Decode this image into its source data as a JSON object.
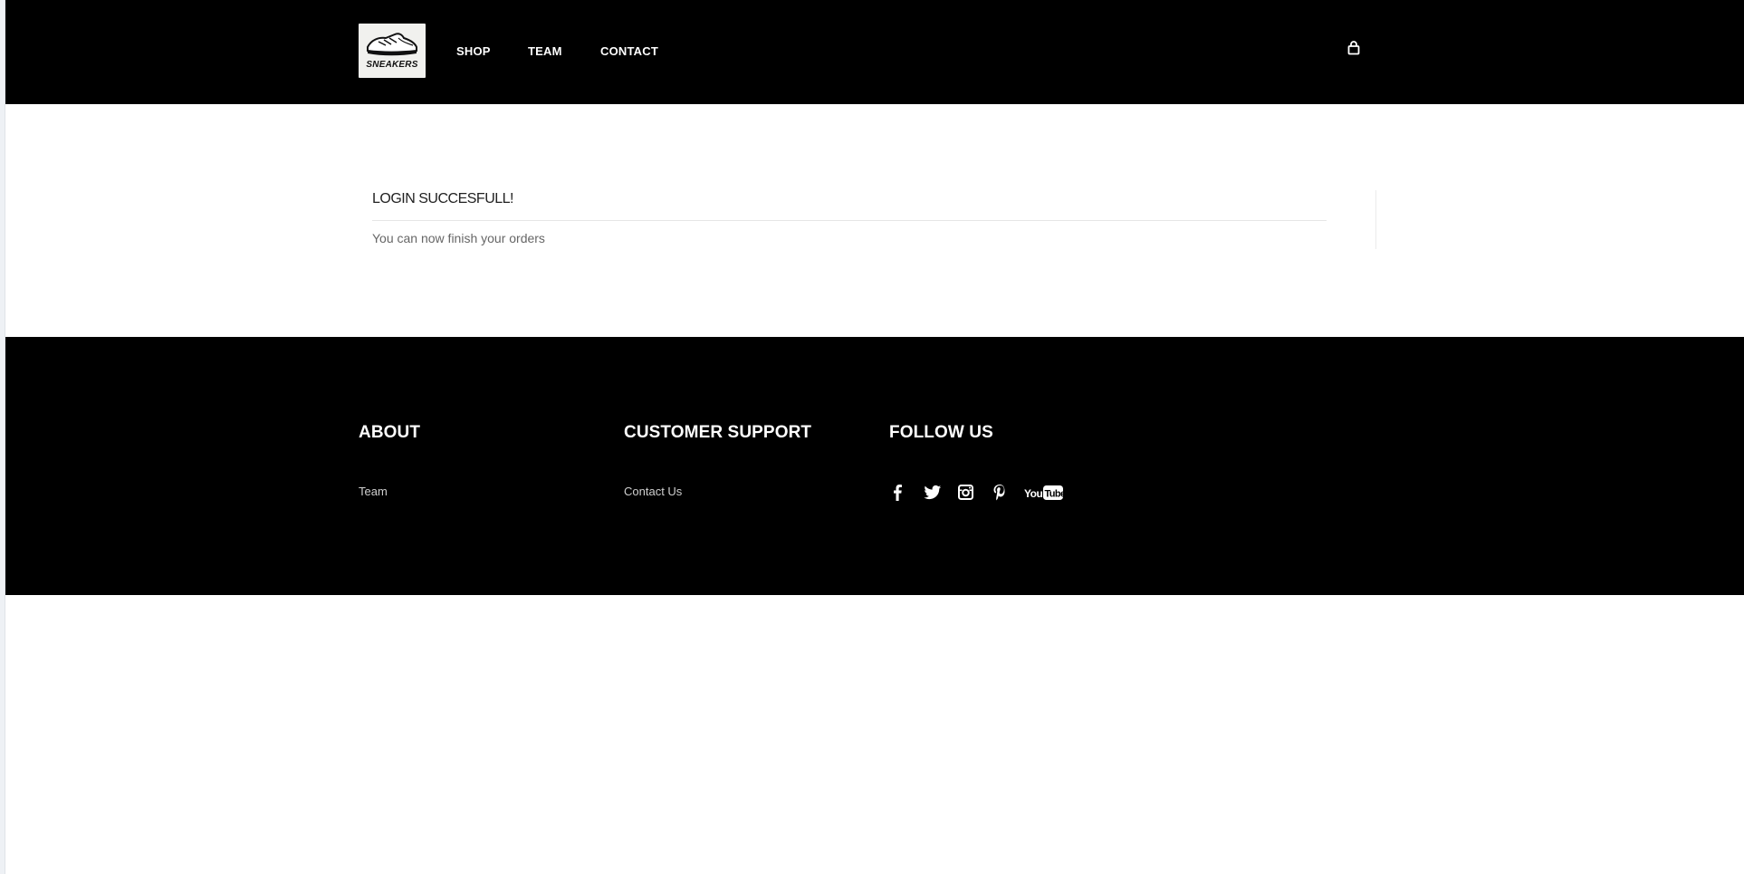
{
  "header": {
    "logo_text": "SNEAKERS",
    "nav": [
      {
        "label": "SHOP"
      },
      {
        "label": "TEAM"
      },
      {
        "label": "CONTACT"
      }
    ],
    "cart_icon": "shopping-bag-icon"
  },
  "notice": {
    "title": "LOGIN SUCCESFULL!",
    "message": "You can now finish your orders"
  },
  "footer": {
    "about": {
      "heading": "ABOUT",
      "link": "Team"
    },
    "support": {
      "heading": "CUSTOMER SUPPORT",
      "link": "Contact Us"
    },
    "follow": {
      "heading": "FOLLOW US",
      "icons": [
        "facebook-icon",
        "twitter-icon",
        "instagram-icon",
        "pinterest-icon",
        "youtube-icon"
      ]
    }
  },
  "colors": {
    "header_bg": "#000000",
    "footer_bg": "#000000",
    "page_bg": "#ffffff",
    "text_muted": "#666666"
  }
}
